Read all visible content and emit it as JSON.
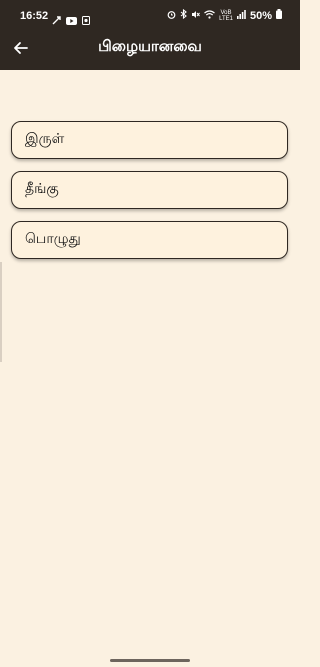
{
  "status_bar": {
    "time": "16:52",
    "battery": "50%",
    "network_top": "VoB",
    "network_bottom": "LTE1"
  },
  "app_bar": {
    "title": "பிழையானவை",
    "back_icon": "arrow-left-icon"
  },
  "options": [
    {
      "label": "இருள்"
    },
    {
      "label": "தீங்கு"
    },
    {
      "label": "பொழுது"
    }
  ],
  "colors": {
    "header": "#2f2822",
    "background": "#fbf1e1",
    "option_fill": "#fef2de",
    "option_border": "#2f2822"
  }
}
